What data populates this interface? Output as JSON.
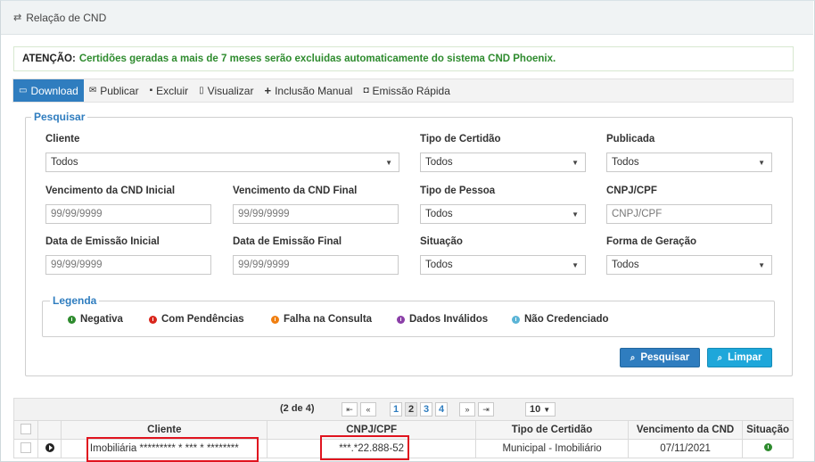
{
  "panel": {
    "title": "Relação de CND"
  },
  "alert": {
    "label": "ATENÇÃO:",
    "message": "Certidões geradas a mais de 7 meses serão excluidas automaticamente do sistema CND Phoenix."
  },
  "toolbar": {
    "download": "Download",
    "publicar": "Publicar",
    "excluir": "Excluir",
    "visualizar": "Visualizar",
    "inclusao": "Inclusão Manual",
    "emissao": "Emissão Rápida"
  },
  "search": {
    "legend": "Pesquisar",
    "cliente_label": "Cliente",
    "cliente_value": "Todos",
    "tipo_certidao_label": "Tipo de Certidão",
    "tipo_certidao_value": "Todos",
    "publicada_label": "Publicada",
    "publicada_value": "Todos",
    "venc_ini_label": "Vencimento da CND Inicial",
    "venc_ini_placeholder": "99/99/9999",
    "venc_fim_label": "Vencimento da CND Final",
    "venc_fim_placeholder": "99/99/9999",
    "tipo_pessoa_label": "Tipo de Pessoa",
    "tipo_pessoa_value": "Todos",
    "cnpj_label": "CNPJ/CPF",
    "cnpj_placeholder": "CNPJ/CPF",
    "emissao_ini_label": "Data de Emissão Inicial",
    "emissao_ini_placeholder": "99/99/9999",
    "emissao_fim_label": "Data de Emissão Final",
    "emissao_fim_placeholder": "99/99/9999",
    "situacao_label": "Situação",
    "situacao_value": "Todos",
    "forma_label": "Forma de Geração",
    "forma_value": "Todos"
  },
  "legend": {
    "title": "Legenda",
    "items": [
      {
        "label": "Negativa",
        "color": "#2e8b2e"
      },
      {
        "label": "Com Pendências",
        "color": "#d9261c"
      },
      {
        "label": "Falha na Consulta",
        "color": "#f07f10"
      },
      {
        "label": "Dados Inválidos",
        "color": "#8b3fa8"
      },
      {
        "label": "Não Credenciado",
        "color": "#5ab4d6"
      }
    ]
  },
  "buttons": {
    "pesquisar": "Pesquisar",
    "limpar": "Limpar"
  },
  "pager": {
    "info": "(2 de 4)",
    "pages": [
      "1",
      "2",
      "3",
      "4"
    ],
    "rows_per_page": "10"
  },
  "table": {
    "headers": [
      "Cliente",
      "CNPJ/CPF",
      "Tipo de Certidão",
      "Vencimento da CND",
      "Situação"
    ],
    "rows": [
      {
        "cliente": "Imobiliária ********* * *** * ********",
        "cnpj": "***.*22.888-52",
        "tipo": "Municipal - Imobiliário",
        "vencimento": "07/11/2021"
      }
    ]
  }
}
